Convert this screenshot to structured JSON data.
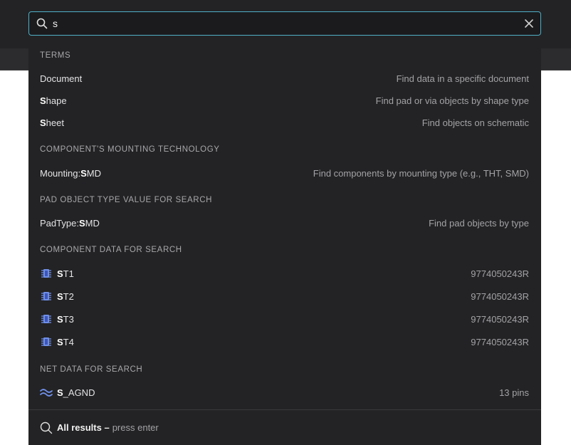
{
  "search": {
    "value": "s",
    "placeholder": ""
  },
  "sections": {
    "terms": {
      "header": "TERMS",
      "rows": [
        {
          "match": "",
          "rest": "Document",
          "desc": "Find data in a specific document"
        },
        {
          "match": "S",
          "rest": "hape",
          "desc": "Find pad or via objects by shape type"
        },
        {
          "match": "S",
          "rest": "heet",
          "desc": "Find objects on schematic"
        }
      ]
    },
    "mounting": {
      "header": "COMPONENT'S MOUNTING TECHNOLOGY",
      "rows": [
        {
          "prefix": "Mounting:",
          "match": "S",
          "rest": "MD",
          "desc": "Find components by mounting type (e.g., THT, SMD)"
        }
      ]
    },
    "padtype": {
      "header": "PAD OBJECT TYPE VALUE FOR SEARCH",
      "rows": [
        {
          "prefix": "PadType:",
          "match": "S",
          "rest": "MD",
          "desc": "Find pad objects by type"
        }
      ]
    },
    "components": {
      "header": "COMPONENT DATA FOR SEARCH",
      "icon": "chip-icon",
      "rows": [
        {
          "match": "S",
          "rest": "T1",
          "desc": "9774050243R"
        },
        {
          "match": "S",
          "rest": "T2",
          "desc": "9774050243R"
        },
        {
          "match": "S",
          "rest": "T3",
          "desc": "9774050243R"
        },
        {
          "match": "S",
          "rest": "T4",
          "desc": "9774050243R"
        }
      ]
    },
    "nets": {
      "header": "NET DATA FOR SEARCH",
      "icon": "net-icon",
      "rows": [
        {
          "match": "S",
          "rest": "_AGND",
          "desc": "13 pins"
        }
      ]
    }
  },
  "footer": {
    "label": "All results –",
    "hint": "press enter"
  },
  "colors": {
    "accent_border": "#4fb0c6",
    "panel_bg": "#232325",
    "icon_blue": "#6f8fe8"
  }
}
